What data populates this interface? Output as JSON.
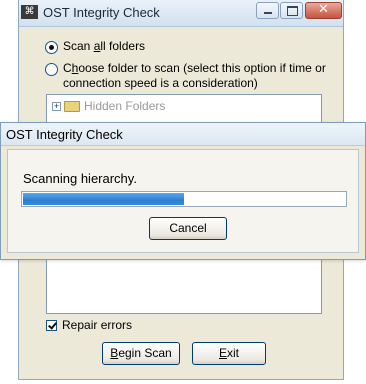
{
  "main_window": {
    "title": "OST Integrity Check",
    "app_icon_glyph": "⌘",
    "close_glyph": "✕",
    "options": {
      "scan_all": {
        "prefix": "Scan ",
        "underlined": "a",
        "suffix": "ll folders"
      },
      "choose": {
        "prefix": "C",
        "underlined": "h",
        "line1_rest": "oose folder to scan (select this option if time or",
        "line2": "connection speed is a consideration)"
      }
    },
    "tree": {
      "item_label": "Hidden Folders"
    },
    "repair": {
      "underlined": "R",
      "rest": "epair errors",
      "checked": true
    },
    "buttons": {
      "begin_scan": {
        "underlined": "B",
        "rest": "egin Scan"
      },
      "exit": {
        "underlined": "E",
        "rest": "xit"
      }
    }
  },
  "progress_dialog": {
    "title": "OST Integrity Check",
    "message": "Scanning hierarchy.",
    "progress_fraction": 0.5,
    "cancel_label": "Cancel"
  },
  "colors": {
    "progress_fill": "#2c7fd2",
    "window_bg": "#ece9d8"
  }
}
